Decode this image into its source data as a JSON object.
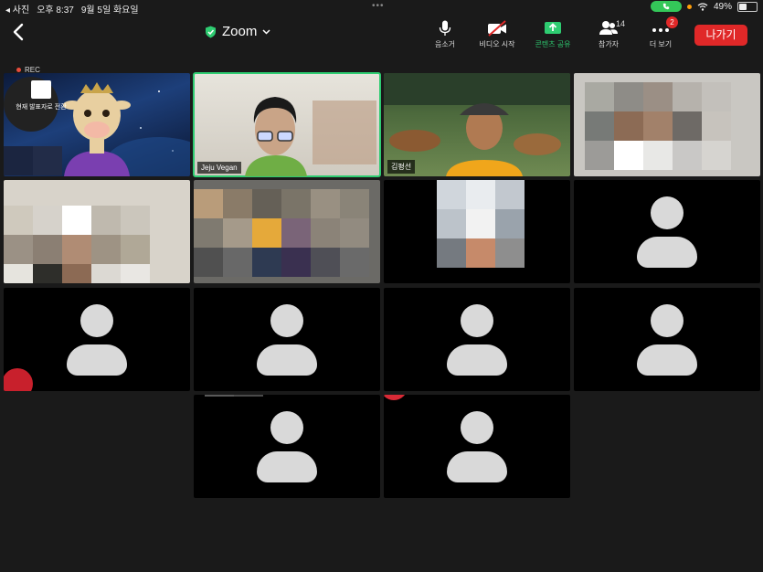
{
  "status_bar": {
    "app": "◂ 사진",
    "time": "오후 8:37",
    "date": "9월 5일 화요일",
    "battery": "49%",
    "battery_level": 0.49
  },
  "toolbar": {
    "title": "Zoom",
    "mute_label": "음소거",
    "video_label": "비디오 시작",
    "share_label": "콘텐츠 공유",
    "participants_label": "참가자",
    "participants_count": "14",
    "more_label": "더 보기",
    "more_badge": "2",
    "leave_label": "나가기"
  },
  "recording": {
    "label": "REC"
  },
  "tiles": {
    "presenter_switch": "현재 발표자로 전환",
    "jeju_vegan": "Jeju Vegan",
    "farmer": "김평선"
  },
  "colors": {
    "accent_green": "#2ecc71",
    "leave_red": "#e02828",
    "call_green": "#34c759"
  }
}
